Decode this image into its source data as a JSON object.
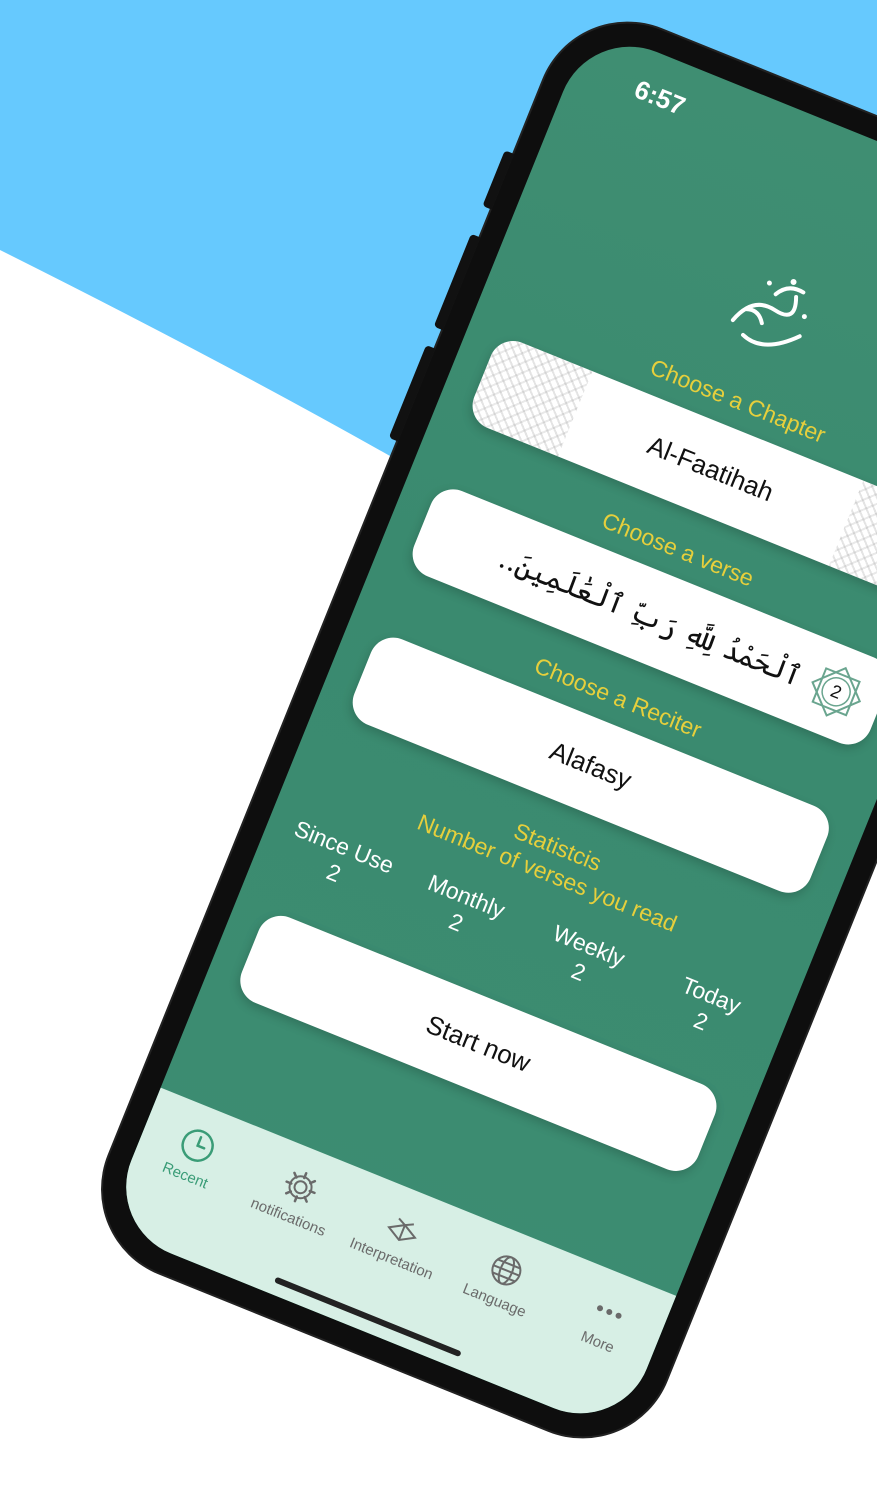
{
  "colors": {
    "backdrop_blue": "#66c9fe",
    "app_green": "#3f8e72",
    "label_yellow": "#e6cf3c",
    "tabbar_bg": "#d7efe5",
    "tab_active": "#3a9c77"
  },
  "status_bar": {
    "time": "6:57"
  },
  "app": {
    "logo_icon": "arabic-calligraphy-logo"
  },
  "chapter": {
    "label": "Choose a Chapter",
    "value": "Al-Faatihah"
  },
  "verse": {
    "label": "Choose a verse",
    "value": "ٱلْحَمْدُ لِلَّهِ رَبِّ ٱلْعَٰلَمِينَ..",
    "number": "2"
  },
  "reciter": {
    "label": "Choose a Reciter",
    "value": "Alafasy"
  },
  "statistics": {
    "title": "Statistcis",
    "subtitle": "Number of verses you read",
    "items": [
      {
        "label": "Since Use",
        "value": "2"
      },
      {
        "label": "Monthly",
        "value": "2"
      },
      {
        "label": "Weekly",
        "value": "2"
      },
      {
        "label": "Today",
        "value": "2"
      }
    ]
  },
  "start_button": {
    "label": "Start now"
  },
  "tabbar": {
    "items": [
      {
        "label": "Recent",
        "icon": "clock-icon",
        "active": true
      },
      {
        "label": "notifications",
        "icon": "gear-icon",
        "active": false
      },
      {
        "label": "Interpretation",
        "icon": "quran-book-icon",
        "active": false
      },
      {
        "label": "Language",
        "icon": "globe-icon",
        "active": false
      },
      {
        "label": "More",
        "icon": "more-dots-icon",
        "active": false
      }
    ]
  }
}
